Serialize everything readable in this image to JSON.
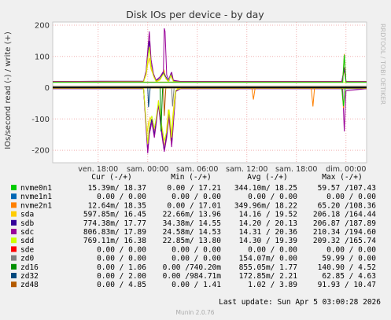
{
  "chart_data": {
    "type": "line",
    "title": "Disk IOs per device - by day",
    "ylabel": "IOs/second read (-) / write (+)",
    "watermark": "RRDTOOL / TOBI OETIKER",
    "footer": "Munin 2.0.76",
    "ylim": [
      -240,
      210
    ],
    "yticks": [
      200,
      100,
      0,
      -100,
      -200
    ],
    "x_range_hours": [
      -5.5,
      32.5
    ],
    "xticks": [
      {
        "label": "ven. 18:00",
        "h": 0
      },
      {
        "label": "sam. 00:00",
        "h": 6
      },
      {
        "label": "sam. 06:00",
        "h": 12
      },
      {
        "label": "sam. 12:00",
        "h": 18
      },
      {
        "label": "sam. 18:00",
        "h": 24
      },
      {
        "label": "dim. 00:00",
        "h": 30
      }
    ],
    "grid": true,
    "legend_header": {
      "cur": "Cur (-/+)",
      "min": "Min (-/+)",
      "avg": "Avg (-/+)",
      "max": "Max (-/+)"
    },
    "legend": [
      {
        "name": "nvme0n1",
        "color": "#00cc00",
        "cur": "15.39m/ 18.37",
        "min": "0.00 / 17.21",
        "avg": "344.10m/ 18.25",
        "max": "59.57 /107.43"
      },
      {
        "name": "nvme1n1",
        "color": "#0066b3",
        "cur": "0.00 / 0.00",
        "min": "0.00 / 0.00",
        "avg": "0.00 / 0.00",
        "max": "0.00 / 0.00"
      },
      {
        "name": "nvme2n1",
        "color": "#ff8000",
        "cur": "12.64m/ 18.35",
        "min": "0.00 / 17.01",
        "avg": "349.96m/ 18.22",
        "max": "65.20 /108.36"
      },
      {
        "name": "sda",
        "color": "#ffcc00",
        "cur": "597.85m/ 16.45",
        "min": "22.66m/ 13.96",
        "avg": "14.16 / 19.52",
        "max": "206.18 /164.44"
      },
      {
        "name": "sdb",
        "color": "#330099",
        "cur": "774.38m/ 17.77",
        "min": "34.38m/ 14.55",
        "avg": "14.20 / 20.13",
        "max": "206.87 /187.89"
      },
      {
        "name": "sdc",
        "color": "#990099",
        "cur": "806.83m/ 17.89",
        "min": "24.58m/ 14.53",
        "avg": "14.31 / 20.36",
        "max": "210.34 /194.60"
      },
      {
        "name": "sdd",
        "color": "#ccff00",
        "cur": "769.11m/ 16.38",
        "min": "22.85m/ 13.80",
        "avg": "14.30 / 19.39",
        "max": "209.32 /165.74"
      },
      {
        "name": "sde",
        "color": "#ff0000",
        "cur": "0.00 / 0.00",
        "min": "0.00 / 0.00",
        "avg": "0.00 / 0.00",
        "max": "0.00 / 0.00"
      },
      {
        "name": "zd0",
        "color": "#808080",
        "cur": "0.00 / 0.00",
        "min": "0.00 / 0.00",
        "avg": "154.07m/ 0.00",
        "max": "59.99 / 0.00"
      },
      {
        "name": "zd16",
        "color": "#008f00",
        "cur": "0.00 / 1.06",
        "min": "0.00 /740.20m",
        "avg": "855.05m/ 1.77",
        "max": "140.90 / 4.52"
      },
      {
        "name": "zd32",
        "color": "#00487d",
        "cur": "0.00 / 2.00",
        "min": "0.00 /984.71m",
        "avg": "172.85m/ 2.21",
        "max": "62.85 / 4.63"
      },
      {
        "name": "zd48",
        "color": "#b35a00",
        "cur": "0.00 / 4.85",
        "min": "0.00 / 1.41",
        "avg": "1.02 / 3.89",
        "max": "91.93 / 10.47"
      }
    ],
    "last_update": "Last update: Sun Apr  5 03:00:28 2026",
    "series": [
      {
        "name": "sda",
        "color": "#ffcc00",
        "points": [
          [
            -5.5,
            19
          ],
          [
            5,
            19
          ],
          [
            5.5,
            20
          ],
          [
            5.8,
            40
          ],
          [
            6.0,
            75
          ],
          [
            6.2,
            95
          ],
          [
            6.4,
            60
          ],
          [
            6.6,
            45
          ],
          [
            6.8,
            30
          ],
          [
            7.1,
            20
          ],
          [
            7.5,
            25
          ],
          [
            7.8,
            40
          ],
          [
            8.0,
            55
          ],
          [
            8.2,
            28
          ],
          [
            8.5,
            20
          ],
          [
            8.8,
            38
          ],
          [
            9.0,
            25
          ],
          [
            9.3,
            19
          ],
          [
            10,
            19
          ],
          [
            18,
            18
          ],
          [
            29.5,
            18
          ],
          [
            29.8,
            55
          ],
          [
            30.0,
            19
          ],
          [
            32.5,
            19
          ],
          [
            -5.5,
            -2
          ],
          [
            5.5,
            -2
          ],
          [
            5.7,
            -90
          ],
          [
            5.9,
            -150
          ],
          [
            6.1,
            -110
          ],
          [
            6.3,
            -95
          ],
          [
            6.6,
            -120
          ],
          [
            6.9,
            -140
          ],
          [
            7.1,
            -90
          ],
          [
            7.3,
            -40
          ],
          [
            7.6,
            -110
          ],
          [
            7.9,
            -160
          ],
          [
            8.1,
            -190
          ],
          [
            8.3,
            -130
          ],
          [
            8.5,
            -70
          ],
          [
            8.8,
            -170
          ],
          [
            9.0,
            -100
          ],
          [
            9.3,
            -20
          ],
          [
            9.6,
            -3
          ],
          [
            18,
            -2
          ],
          [
            32.5,
            -2
          ]
        ]
      },
      {
        "name": "sdb",
        "color": "#330099",
        "points": [
          [
            -5.5,
            20
          ],
          [
            5.5,
            21
          ],
          [
            5.8,
            50
          ],
          [
            6.0,
            110
          ],
          [
            6.2,
            150
          ],
          [
            6.4,
            75
          ],
          [
            6.7,
            40
          ],
          [
            7.0,
            22
          ],
          [
            7.5,
            30
          ],
          [
            7.9,
            48
          ],
          [
            8.2,
            35
          ],
          [
            8.5,
            22
          ],
          [
            8.8,
            45
          ],
          [
            9.1,
            22
          ],
          [
            10,
            20
          ],
          [
            29.5,
            20
          ],
          [
            29.8,
            60
          ],
          [
            30,
            20
          ],
          [
            32.5,
            20
          ],
          [
            -5.5,
            -3
          ],
          [
            5.5,
            -3
          ],
          [
            5.8,
            -120
          ],
          [
            6.0,
            -205
          ],
          [
            6.2,
            -140
          ],
          [
            6.5,
            -100
          ],
          [
            6.8,
            -150
          ],
          [
            7.0,
            -110
          ],
          [
            7.3,
            -50
          ],
          [
            7.7,
            -140
          ],
          [
            8.0,
            -200
          ],
          [
            8.3,
            -150
          ],
          [
            8.6,
            -80
          ],
          [
            8.9,
            -180
          ],
          [
            9.1,
            -110
          ],
          [
            9.4,
            -10
          ],
          [
            10,
            -3
          ],
          [
            32.5,
            -3
          ]
        ]
      },
      {
        "name": "sdc",
        "color": "#990099",
        "points": [
          [
            -5.5,
            20
          ],
          [
            5.5,
            21
          ],
          [
            5.8,
            55
          ],
          [
            6.0,
            120
          ],
          [
            6.2,
            180
          ],
          [
            6.4,
            90
          ],
          [
            6.7,
            45
          ],
          [
            7.0,
            24
          ],
          [
            7.5,
            35
          ],
          [
            7.9,
            52
          ],
          [
            8.0,
            190
          ],
          [
            8.1,
            180
          ],
          [
            8.3,
            40
          ],
          [
            8.6,
            24
          ],
          [
            8.9,
            50
          ],
          [
            9.1,
            24
          ],
          [
            10,
            20
          ],
          [
            29.5,
            20
          ],
          [
            29.8,
            65
          ],
          [
            30,
            20
          ],
          [
            32.5,
            20
          ],
          [
            -5.5,
            -3
          ],
          [
            5.5,
            -3
          ],
          [
            5.8,
            -130
          ],
          [
            6.0,
            -210
          ],
          [
            6.2,
            -150
          ],
          [
            6.5,
            -110
          ],
          [
            6.8,
            -160
          ],
          [
            7.0,
            -120
          ],
          [
            7.3,
            -55
          ],
          [
            7.7,
            -150
          ],
          [
            8.0,
            -205
          ],
          [
            8.3,
            -160
          ],
          [
            8.6,
            -90
          ],
          [
            8.9,
            -190
          ],
          [
            9.1,
            -120
          ],
          [
            9.4,
            -12
          ],
          [
            10,
            -3
          ],
          [
            29.6,
            -3
          ],
          [
            29.8,
            -140
          ],
          [
            30.0,
            -10
          ],
          [
            32.5,
            -3
          ]
        ]
      },
      {
        "name": "sdd",
        "color": "#ccff00",
        "points": [
          [
            -5.5,
            18
          ],
          [
            5.5,
            19
          ],
          [
            5.8,
            45
          ],
          [
            6.0,
            90
          ],
          [
            6.2,
            130
          ],
          [
            6.4,
            70
          ],
          [
            6.7,
            38
          ],
          [
            7.0,
            20
          ],
          [
            7.5,
            28
          ],
          [
            7.9,
            44
          ],
          [
            8.2,
            30
          ],
          [
            8.5,
            20
          ],
          [
            8.8,
            40
          ],
          [
            9.1,
            20
          ],
          [
            10,
            18
          ],
          [
            32.5,
            18
          ],
          [
            -5.5,
            -2
          ],
          [
            5.5,
            -2
          ],
          [
            5.8,
            -110
          ],
          [
            6.0,
            -180
          ],
          [
            6.2,
            -120
          ],
          [
            6.5,
            -90
          ],
          [
            6.8,
            -130
          ],
          [
            7.0,
            -100
          ],
          [
            7.3,
            -45
          ],
          [
            7.7,
            -120
          ],
          [
            8.0,
            -170
          ],
          [
            8.3,
            -140
          ],
          [
            8.6,
            -70
          ],
          [
            8.9,
            -160
          ],
          [
            9.1,
            -90
          ],
          [
            9.4,
            -8
          ],
          [
            10,
            -2
          ],
          [
            32.5,
            -2
          ]
        ]
      },
      {
        "name": "nvme2n1",
        "color": "#ff8000",
        "points": [
          [
            -5.5,
            18
          ],
          [
            29.6,
            18
          ],
          [
            29.8,
            108
          ],
          [
            30.0,
            18
          ],
          [
            32.5,
            18
          ],
          [
            -5.5,
            -1
          ],
          [
            18.6,
            -1
          ],
          [
            18.8,
            -38
          ],
          [
            19.0,
            -1
          ],
          [
            25.8,
            -1
          ],
          [
            26.0,
            -60
          ],
          [
            26.2,
            -1
          ],
          [
            29.5,
            -1
          ],
          [
            29.7,
            -65
          ],
          [
            29.9,
            -1
          ],
          [
            32.5,
            -1
          ]
        ]
      },
      {
        "name": "nvme0n1",
        "color": "#00cc00",
        "points": [
          [
            -5.5,
            17
          ],
          [
            29.6,
            17
          ],
          [
            29.8,
            105
          ],
          [
            30.0,
            17
          ],
          [
            32.5,
            17
          ],
          [
            -5.5,
            -1
          ],
          [
            29.5,
            -1
          ],
          [
            29.7,
            -59
          ],
          [
            29.9,
            -1
          ],
          [
            32.5,
            -1
          ]
        ]
      },
      {
        "name": "zd48",
        "color": "#b35a00",
        "points": [
          [
            -5.5,
            4
          ],
          [
            32.5,
            4
          ],
          [
            -5.5,
            -1
          ],
          [
            7.9,
            -1
          ],
          [
            8.0,
            -90
          ],
          [
            8.2,
            -1
          ],
          [
            32.5,
            -1
          ]
        ]
      },
      {
        "name": "zd16",
        "color": "#008f00",
        "points": [
          [
            -5.5,
            2
          ],
          [
            32.5,
            2
          ],
          [
            -5.5,
            0
          ],
          [
            7.5,
            0
          ],
          [
            7.6,
            -140
          ],
          [
            7.8,
            0
          ],
          [
            32.5,
            0
          ]
        ]
      },
      {
        "name": "zd32",
        "color": "#00487d",
        "points": [
          [
            -5.5,
            2
          ],
          [
            32.5,
            2
          ],
          [
            -5.5,
            0
          ],
          [
            6.0,
            0
          ],
          [
            6.1,
            -62
          ],
          [
            6.3,
            0
          ],
          [
            32.5,
            0
          ]
        ]
      },
      {
        "name": "zd0",
        "color": "#808080",
        "points": [
          [
            -5.5,
            0
          ],
          [
            32.5,
            0
          ],
          [
            -5.5,
            0
          ],
          [
            8.9,
            0
          ],
          [
            9.0,
            -60
          ],
          [
            9.2,
            0
          ],
          [
            32.5,
            0
          ]
        ]
      }
    ]
  }
}
